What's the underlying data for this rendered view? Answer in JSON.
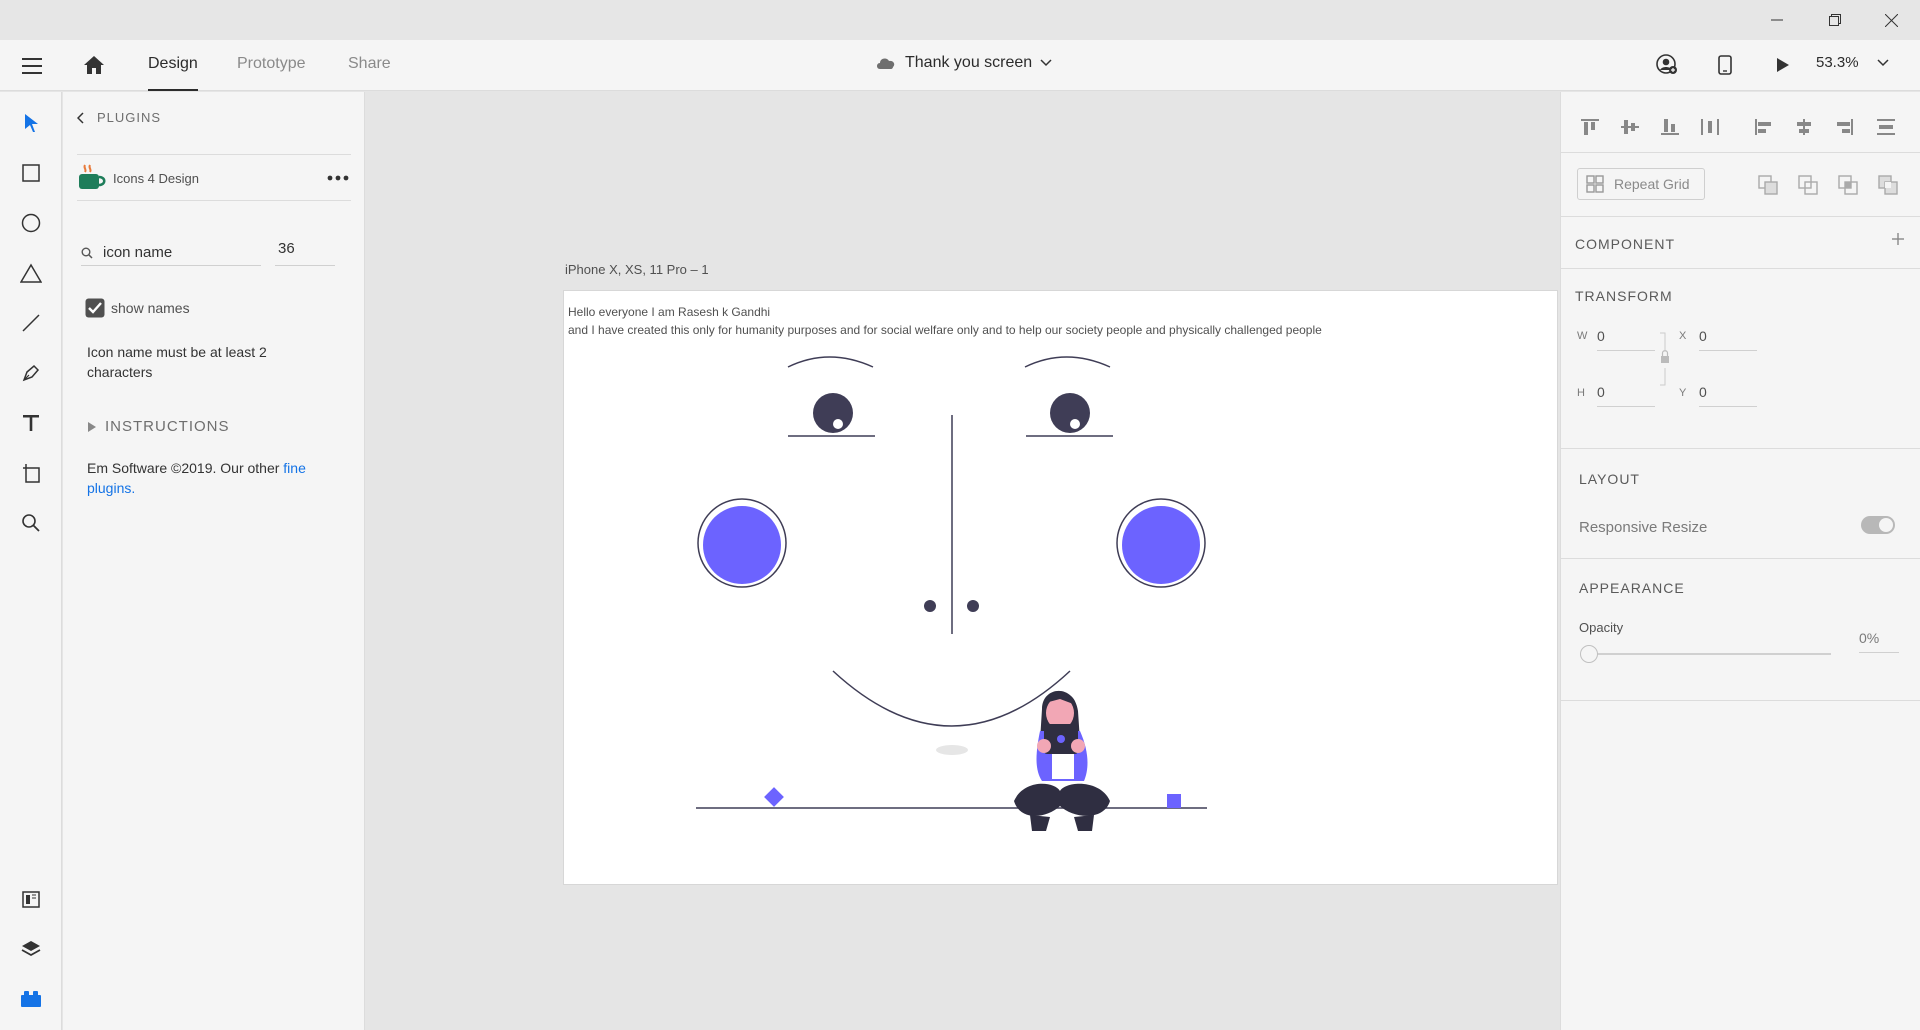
{
  "header": {
    "tabs": [
      {
        "label": "Design",
        "active": true
      },
      {
        "label": "Prototype",
        "active": false
      },
      {
        "label": "Share",
        "active": false
      }
    ],
    "document_title": "Thank you screen",
    "zoom": "53.3%"
  },
  "plugins_panel": {
    "back_label": "PLUGINS",
    "plugin_name": "Icons 4 Design",
    "search_placeholder": "icon name",
    "size_value": "36",
    "show_names_label": "show names",
    "show_names_checked": true,
    "validation_message": "Icon name must be at least 2 characters",
    "instructions_label": "INSTRUCTIONS",
    "footer_text": "Em Software ©2019. Our other ",
    "footer_link": "fine plugins."
  },
  "canvas": {
    "artboard_label": "iPhone X, XS, 11 Pro – 1",
    "text_line_1": "Hello everyone I am Rasesh k Gandhi",
    "text_line_2": "and I have created this only for humanity purposes and for social  welfare only and to help our society people and physically challenged people",
    "colors": {
      "accent": "#6c63ff",
      "dark": "#3f3d56",
      "skin": "#f2a7b5"
    }
  },
  "properties_panel": {
    "repeat_grid_label": "Repeat Grid",
    "component_label": "COMPONENT",
    "transform_label": "TRANSFORM",
    "w_label": "W",
    "w_value": "0",
    "x_label": "X",
    "x_value": "0",
    "h_label": "H",
    "h_value": "0",
    "y_label": "Y",
    "y_value": "0",
    "layout_label": "LAYOUT",
    "responsive_resize_label": "Responsive Resize",
    "appearance_label": "APPEARANCE",
    "opacity_label": "Opacity",
    "opacity_value": "0%"
  },
  "icons": [
    "hamburger-icon",
    "home-icon",
    "cloud-icon",
    "user-icon",
    "mobile-icon",
    "play-icon",
    "select-icon",
    "rectangle-icon",
    "ellipse-icon",
    "triangle-icon",
    "line-icon",
    "pen-icon",
    "text-icon",
    "artboard-icon",
    "zoom-icon",
    "assets-icon",
    "layers-icon",
    "plugins-icon"
  ]
}
